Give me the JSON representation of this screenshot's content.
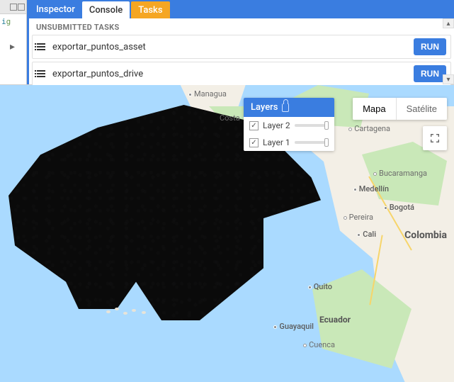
{
  "tabs": {
    "inspector": "Inspector",
    "console": "Console",
    "tasks": "Tasks"
  },
  "tasks": {
    "header": "UNSUBMITTED TASKS",
    "items": [
      {
        "name": "exportar_puntos_asset",
        "run": "RUN"
      },
      {
        "name": "exportar_puntos_drive",
        "run": "RUN"
      }
    ]
  },
  "layers": {
    "title": "Layers",
    "items": [
      {
        "label": "Layer 2",
        "checked": true,
        "opacity": 1.0
      },
      {
        "label": "Layer 1",
        "checked": true,
        "opacity": 1.0
      }
    ]
  },
  "maptype": {
    "map": "Mapa",
    "satellite": "Satélite",
    "active": "map"
  },
  "labels": {
    "managua": "Managua",
    "costa": "Costa",
    "cartagena": "Cartagena",
    "bucaramanga": "Bucaramanga",
    "medellin": "Medellín",
    "bogota": "Bogotá",
    "pereira": "Pereira",
    "cali": "Cali",
    "colombia": "Colombia",
    "quito": "Quito",
    "ecuador": "Ecuador",
    "guayaquil": "Guayaquil",
    "cuenca": "Cuenca"
  }
}
